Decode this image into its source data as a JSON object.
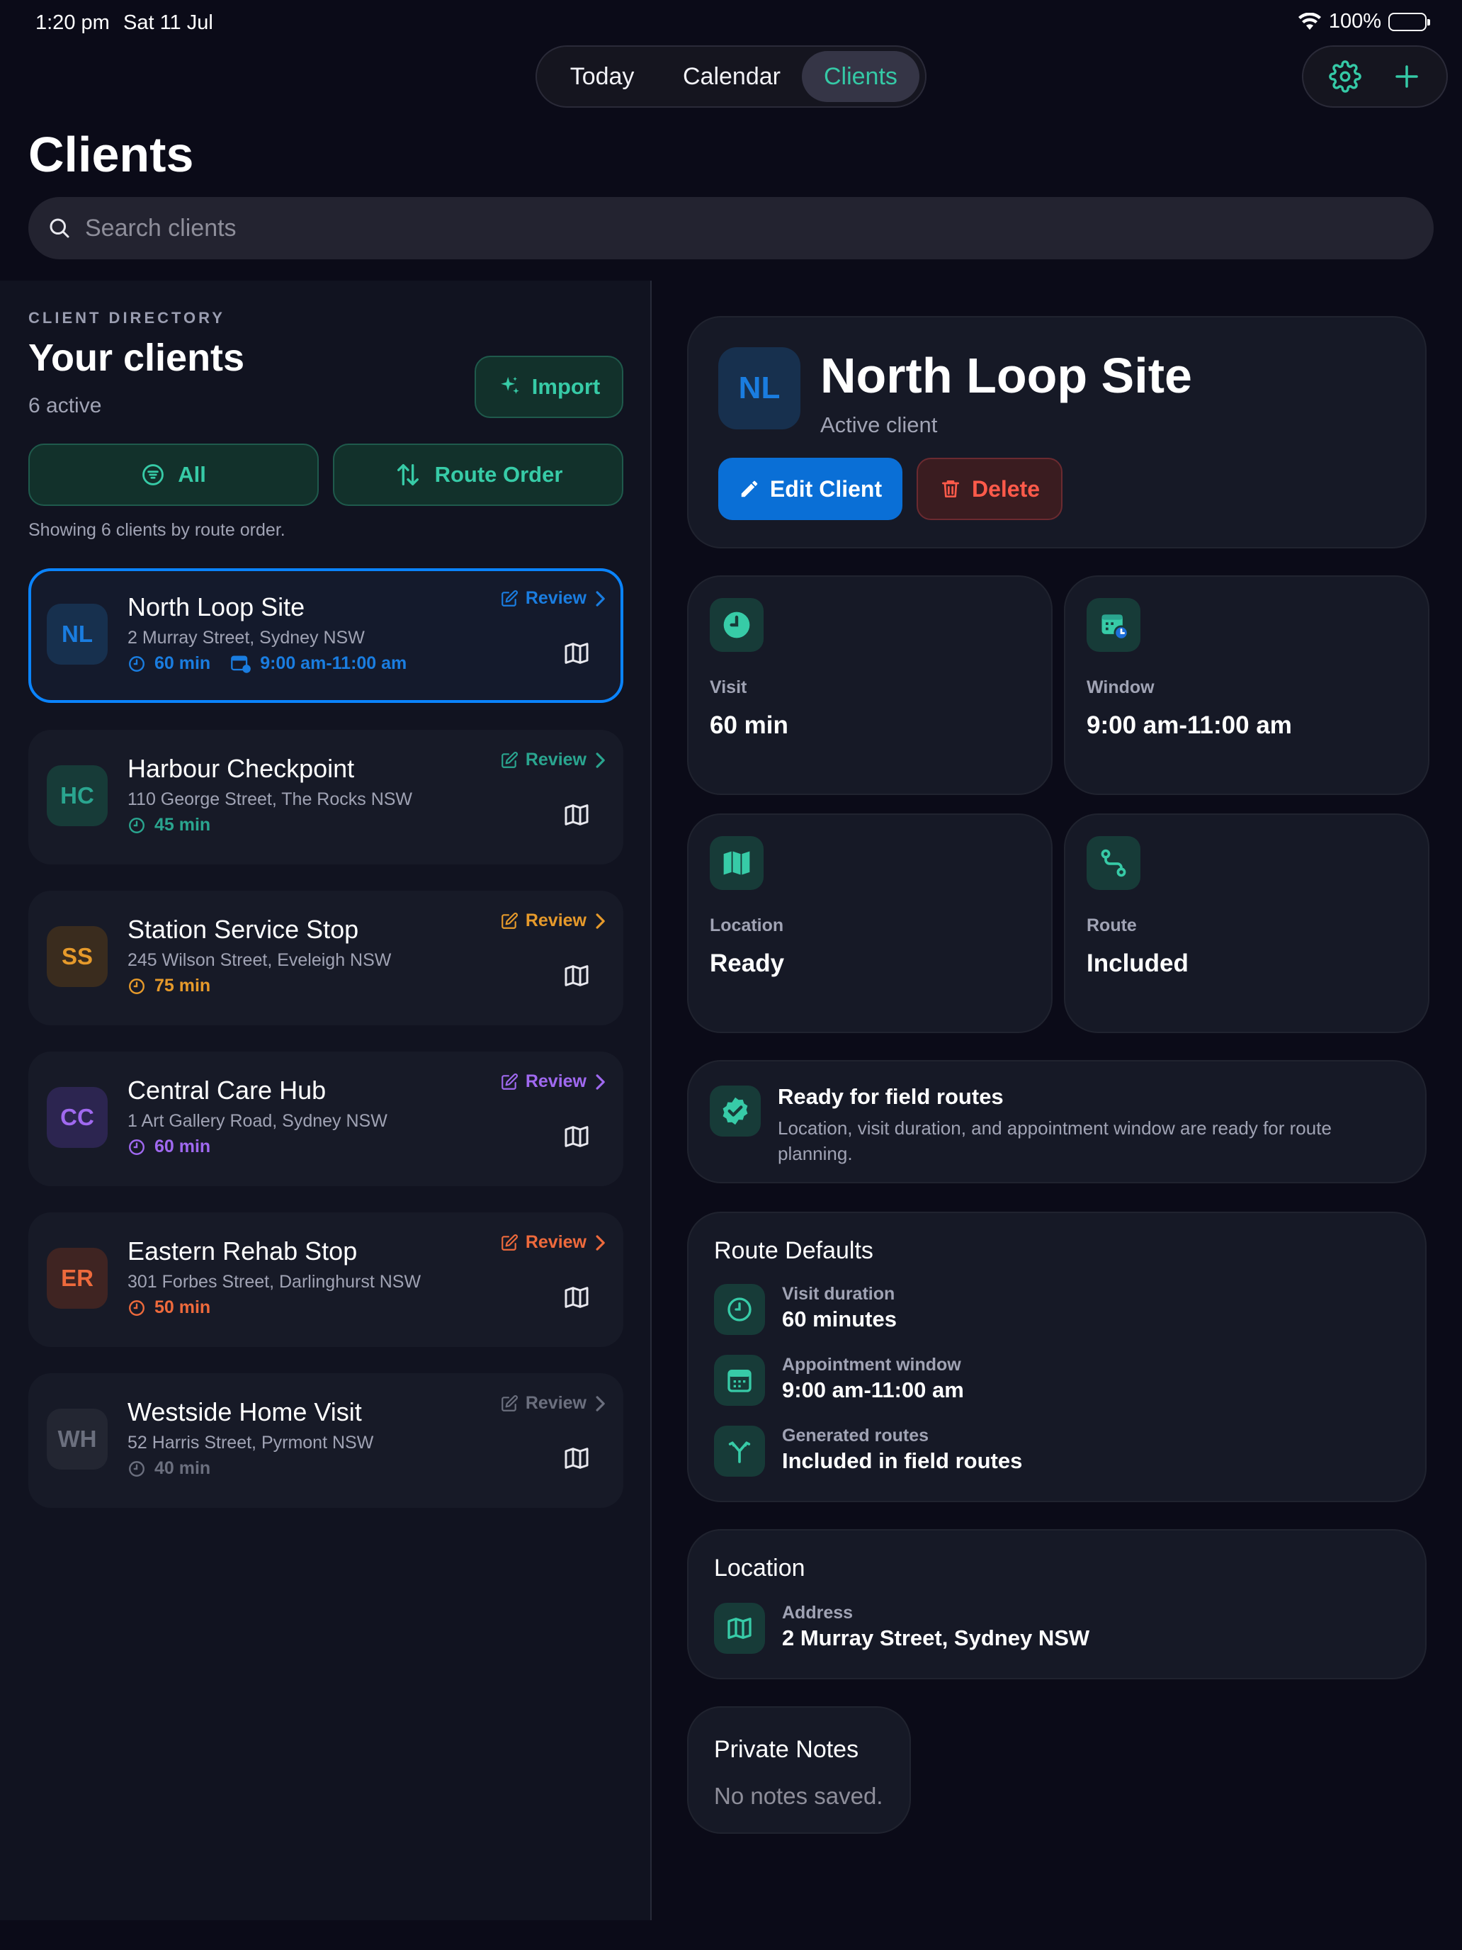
{
  "status_bar": {
    "time": "1:20 pm",
    "date": "Sat 11 Jul",
    "battery": "100%"
  },
  "nav": {
    "tabs": [
      "Today",
      "Calendar",
      "Clients"
    ],
    "active": "Clients"
  },
  "page": {
    "title": "Clients"
  },
  "search": {
    "placeholder": "Search clients"
  },
  "directory": {
    "eyebrow": "CLIENT DIRECTORY",
    "title": "Your clients",
    "count": "6 active",
    "import_label": "Import",
    "filter_all_label": "All",
    "filter_route_label": "Route Order",
    "showing_text": "Showing 6 clients by route order.",
    "review_label": "Review",
    "clients": [
      {
        "initials": "NL",
        "name": "North Loop Site",
        "address": "2 Murray Street, Sydney NSW",
        "duration": "60 min",
        "window": "9:00 am-11:00 am",
        "color": "#1a7de0",
        "avatar_bg": "#17304e",
        "selected": true
      },
      {
        "initials": "HC",
        "name": "Harbour Checkpoint",
        "address": "110 George Street, The Rocks NSW",
        "duration": "45 min",
        "color": "#2aa58f",
        "avatar_bg": "#173b38"
      },
      {
        "initials": "SS",
        "name": "Station Service Stop",
        "address": "245 Wilson Street, Eveleigh NSW",
        "duration": "75 min",
        "color": "#e69a2b",
        "avatar_bg": "#3a2c1e"
      },
      {
        "initials": "CC",
        "name": "Central Care Hub",
        "address": "1 Art Gallery Road, Sydney NSW",
        "duration": "60 min",
        "color": "#a069f0",
        "avatar_bg": "#2c2550"
      },
      {
        "initials": "ER",
        "name": "Eastern Rehab Stop",
        "address": "301 Forbes Street, Darlinghurst NSW",
        "duration": "50 min",
        "color": "#ee6a3c",
        "avatar_bg": "#3f2422"
      },
      {
        "initials": "WH",
        "name": "Westside Home Visit",
        "address": "52 Harris Street, Pyrmont NSW",
        "duration": "40 min",
        "color": "#6b6f7e",
        "avatar_bg": "#232632"
      }
    ]
  },
  "detail": {
    "initials": "NL",
    "name": "North Loop Site",
    "status": "Active client",
    "edit_label": "Edit Client",
    "delete_label": "Delete",
    "stats": {
      "visit": {
        "label": "Visit",
        "value": "60 min",
        "icon": "clock-icon"
      },
      "window": {
        "label": "Window",
        "value": "9:00 am-11:00 am",
        "icon": "calendar-clock-icon"
      },
      "location": {
        "label": "Location",
        "value": "Ready",
        "icon": "map-icon"
      },
      "route": {
        "label": "Route",
        "value": "Included",
        "icon": "route-icon"
      }
    },
    "ready": {
      "title": "Ready for field routes",
      "description": "Location, visit duration, and appointment window are ready for route planning."
    },
    "route_defaults": {
      "title": "Route Defaults",
      "duration_label": "Visit duration",
      "duration_value": "60 minutes",
      "window_label": "Appointment window",
      "window_value": "9:00 am-11:00 am",
      "generated_label": "Generated routes",
      "generated_value": "Included in field routes"
    },
    "location": {
      "title": "Location",
      "address_label": "Address",
      "address_value": "2 Murray Street, Sydney NSW"
    },
    "notes": {
      "title": "Private Notes",
      "empty": "No notes saved."
    }
  },
  "colors": {
    "accent": "#35c9a6",
    "primary_button": "#0a6fd6",
    "danger": "#ff5a4a",
    "background": "#0b0b18"
  }
}
